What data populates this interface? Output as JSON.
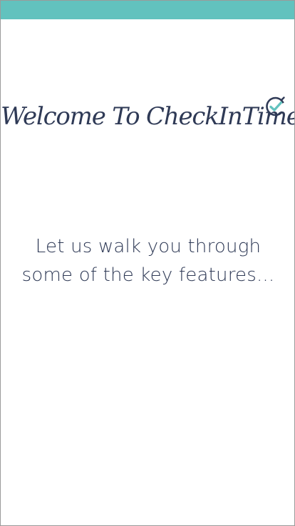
{
  "header": {
    "status_bar_color": "#62c2be"
  },
  "welcome": {
    "title": "Welcome To CheckInTime",
    "logo_icon": "check-clock-icon"
  },
  "intro": {
    "line1": "Let us walk you through",
    "line2": "some of the key features..."
  },
  "colors": {
    "accent": "#62c2be",
    "text": "#2f3a56",
    "background": "#ffffff"
  }
}
